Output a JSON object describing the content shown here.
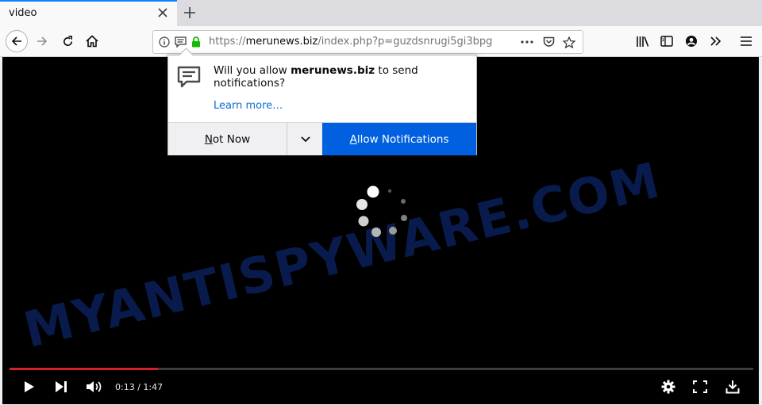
{
  "tab": {
    "title": "video"
  },
  "urlbar": {
    "scheme": "https://",
    "host": "merunews.biz",
    "path": "/index.php?p=guzdsnrugi5gi3bpg"
  },
  "popup": {
    "msg_prefix": "Will you allow ",
    "msg_site": "merunews.biz",
    "msg_suffix": " to send notifications?",
    "learn_more": "Learn more…",
    "not_now_accel": "N",
    "not_now_rest": "ot Now",
    "allow_accel": "A",
    "allow_rest": "llow Notifications"
  },
  "watermark": "MYANTISPYWARE.COM",
  "player": {
    "current_time": "0:13",
    "duration": "1:47",
    "progress_fraction": 0.2,
    "accent_color": "#d42020"
  },
  "colors": {
    "allow_button": "#0060df",
    "tab_highlight": "#0a84ff",
    "link": "#0a6dd0"
  },
  "icons": [
    "close-icon",
    "plus-icon",
    "back-arrow-icon",
    "forward-arrow-icon",
    "reload-icon",
    "home-icon",
    "info-icon",
    "notification-icon",
    "lock-icon",
    "more-icon",
    "pocket-icon",
    "star-icon",
    "library-icon",
    "sidebar-icon",
    "account-icon",
    "overflow-icon",
    "menu-icon",
    "chevron-down-icon",
    "play-icon",
    "next-icon",
    "volume-icon",
    "settings-icon",
    "fullscreen-icon",
    "download-icon"
  ]
}
